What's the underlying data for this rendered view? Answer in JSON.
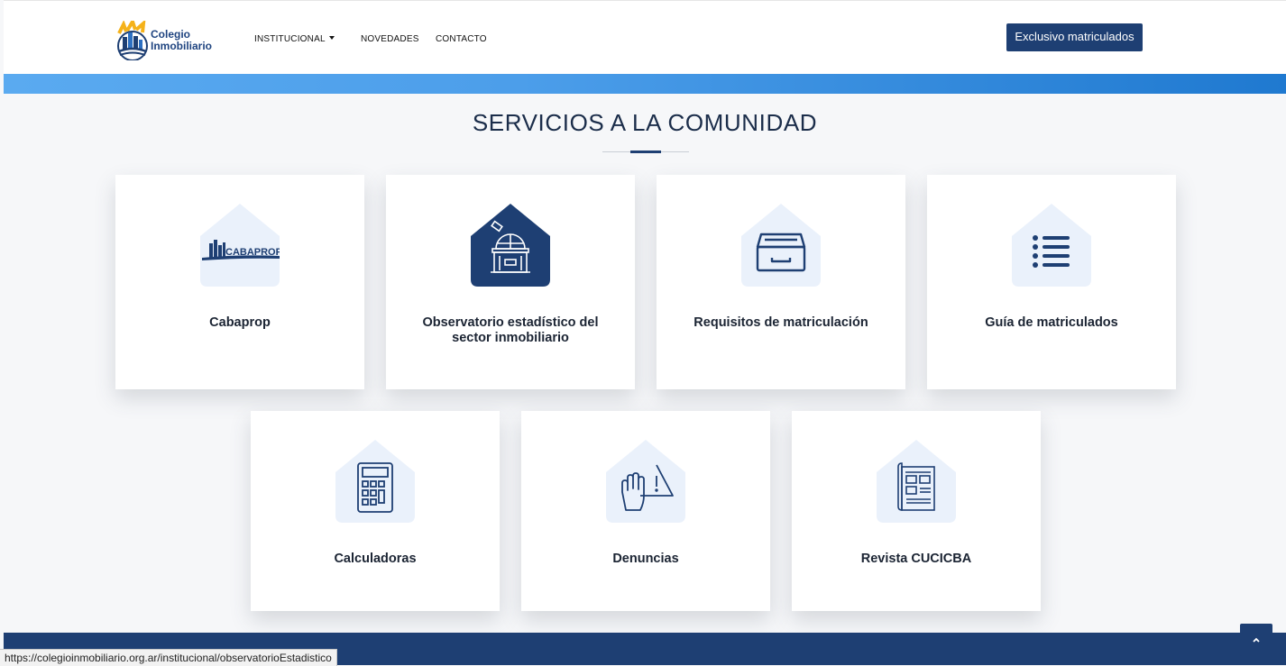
{
  "header": {
    "logo_line1": "Colegio",
    "logo_line2": "Inmobiliario",
    "nav": {
      "institucional": "INSTITUCIONAL",
      "novedades": "NOVEDADES",
      "contacto": "CONTACTO"
    },
    "exclusive_button": "Exclusivo matriculados"
  },
  "section": {
    "title": "SERVICIOS A LA COMUNIDAD"
  },
  "cards": [
    {
      "label": "Cabaprop",
      "icon": "cabaprop-logo-icon",
      "logo_text": "CABAPROP"
    },
    {
      "label": "Observatorio estadístico del sector inmobiliario",
      "icon": "observatory-icon"
    },
    {
      "label": "Requisitos de matriculación",
      "icon": "drawer-icon"
    },
    {
      "label": "Guía de matriculados",
      "icon": "list-icon"
    },
    {
      "label": "Calculadoras",
      "icon": "calculator-icon"
    },
    {
      "label": "Denuncias",
      "icon": "hand-warning-icon"
    },
    {
      "label": "Revista CUCICBA",
      "icon": "magazine-icon"
    }
  ],
  "status_bar": {
    "url": "https://colegioinmobiliario.org.ar/institucional/observatorioEstadistico"
  },
  "colors": {
    "primary": "#1e3f73",
    "icon_bg": "#eaf1fb",
    "band_start": "#5aaaf0",
    "band_end": "#1f79d0",
    "logo_yellow": "#f5b21a"
  }
}
